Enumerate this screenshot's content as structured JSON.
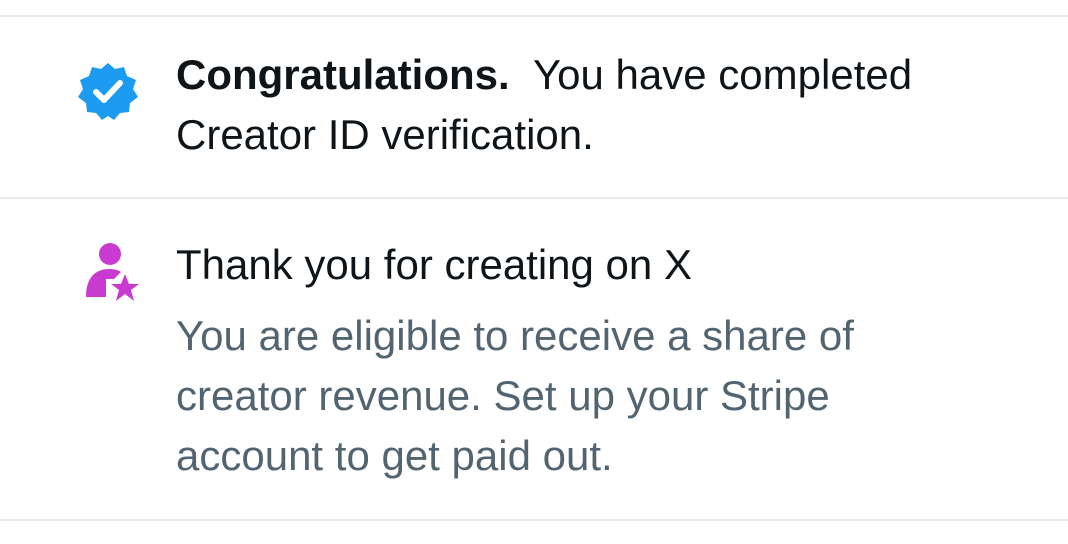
{
  "verification_notice": {
    "icon": "verified-badge-icon",
    "icon_color": "#1d9bf0",
    "lead": "Congratulations.",
    "lines": [
      "You have completed",
      "Creator ID verification."
    ]
  },
  "creator_notice": {
    "icon": "creator-star-icon",
    "icon_color": "#c93bd0",
    "title": "Thank you for creating on X",
    "description_lines": [
      "You are eligible to receive a share of",
      "creator revenue. Set up your Stripe",
      "account to get paid out."
    ]
  },
  "colors": {
    "text_primary": "#0f1419",
    "text_secondary": "#536471",
    "divider": "#e6e9ea"
  }
}
